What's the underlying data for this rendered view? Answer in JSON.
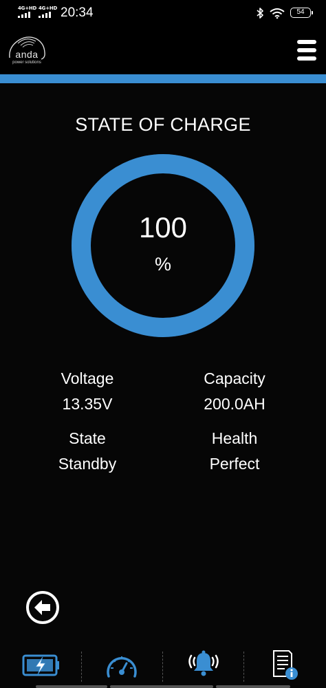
{
  "status_bar": {
    "network_1": "4G+HD",
    "network_2": "4G+HD",
    "time": "20:34",
    "battery_level": "54"
  },
  "header": {
    "logo_name": "anda",
    "logo_tagline": "power solutions",
    "menu_icon": "hamburger-menu-icon"
  },
  "colors": {
    "accent": "#3a8ed2",
    "background": "#060606",
    "text": "#ffffff"
  },
  "main": {
    "title": "STATE OF CHARGE",
    "state_of_charge": {
      "value": "100",
      "unit": "%",
      "fraction": 1.0
    },
    "stats": {
      "voltage": {
        "label": "Voltage",
        "value": "13.35V"
      },
      "capacity": {
        "label": "Capacity",
        "value": "200.0AH"
      },
      "state": {
        "label": "State",
        "value": "Standby"
      },
      "health": {
        "label": "Health",
        "value": "Perfect"
      }
    }
  },
  "back_icon": "back-arrow-icon",
  "bottom_nav": [
    {
      "icon": "battery-charging-icon"
    },
    {
      "icon": "speedometer-icon"
    },
    {
      "icon": "alarm-bell-icon"
    },
    {
      "icon": "document-info-icon"
    }
  ]
}
